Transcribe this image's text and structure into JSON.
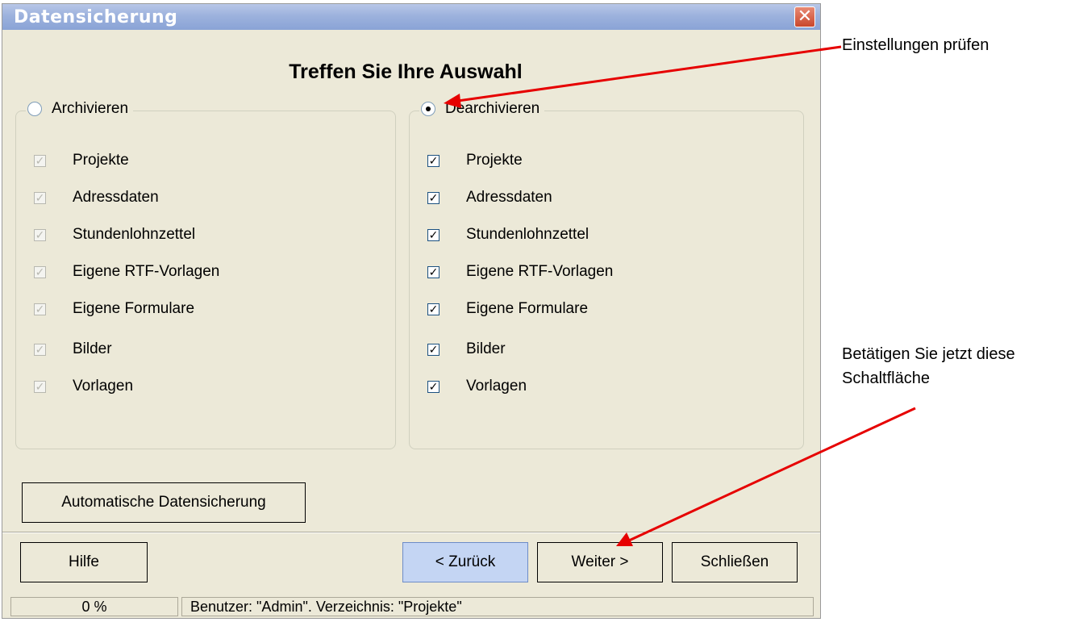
{
  "window": {
    "title": "Datensicherung",
    "close_glyph": "✕"
  },
  "heading": "Treffen Sie Ihre Auswahl",
  "archive_group": {
    "radio_label": "Archivieren",
    "selected": false,
    "items": [
      "Projekte",
      "Adressdaten",
      "Stundenlohnzettel",
      "Eigene RTF-Vorlagen",
      "Eigene Formulare",
      "Bilder",
      "Vorlagen"
    ]
  },
  "restore_group": {
    "radio_label": "Dearchivieren",
    "selected": true,
    "items": [
      "Projekte",
      "Adressdaten",
      "Stundenlohnzettel",
      "Eigene RTF-Vorlagen",
      "Eigene Formulare",
      "Bilder",
      "Vorlagen"
    ]
  },
  "check_glyph": "✓",
  "buttons": {
    "auto_backup": "Automatische Datensicherung",
    "help": "Hilfe",
    "back": "< Zurück",
    "next": "Weiter >",
    "close": "Schließen"
  },
  "status": {
    "progress": "0 %",
    "info": "Benutzer: \"Admin\". Verzeichnis: \"Projekte\""
  },
  "annotations": {
    "top": "Einstellungen prüfen",
    "bottom_line1": "Betätigen Sie jetzt diese",
    "bottom_line2": "Schaltfläche"
  },
  "colors": {
    "arrow": "#e60000",
    "titlebar": "#9cb2dd",
    "dialog_bg": "#ece9d8"
  }
}
